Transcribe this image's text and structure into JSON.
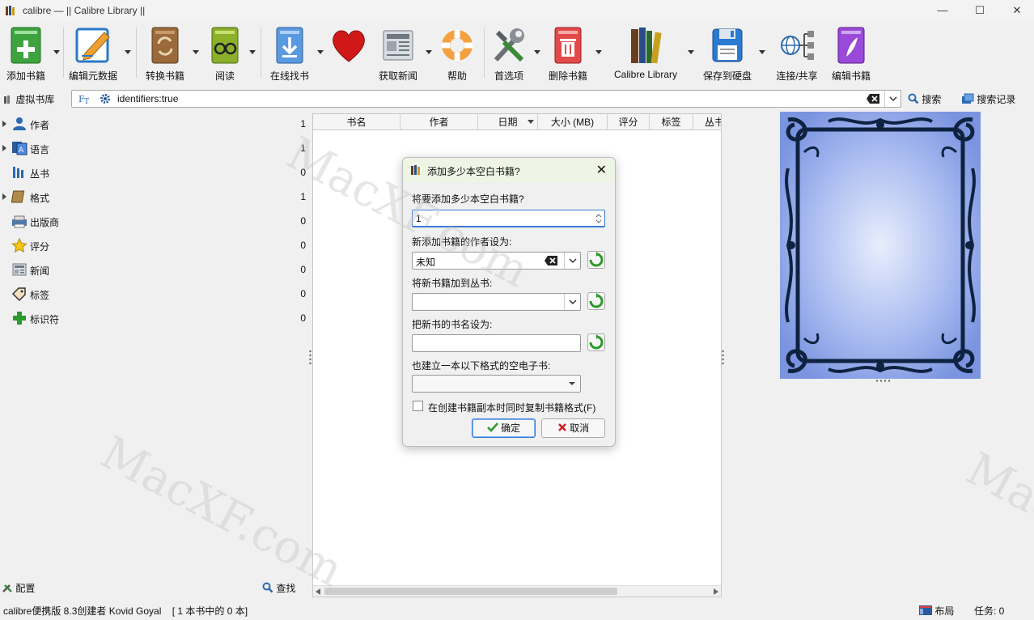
{
  "window": {
    "title": "calibre — || Calibre Library ||"
  },
  "toolbar": {
    "items": [
      {
        "label": "添加书籍"
      },
      {
        "label": "编辑元数据"
      },
      {
        "label": "转换书籍"
      },
      {
        "label": "阅读"
      },
      {
        "label": "在线找书"
      },
      {
        "label": "获取新闻"
      },
      {
        "label": "帮助"
      },
      {
        "label": "首选项"
      },
      {
        "label": "删除书籍"
      },
      {
        "label": "Calibre Library"
      },
      {
        "label": "保存到硬盘"
      },
      {
        "label": "连接/共享"
      },
      {
        "label": "编辑书籍"
      }
    ]
  },
  "search": {
    "virtual_library": "虚拟书库",
    "query": "identifiers:true",
    "search_button": "搜索",
    "history_button": "搜索记录"
  },
  "tag_browser": {
    "items": [
      {
        "label": "作者",
        "count": "1"
      },
      {
        "label": "语言",
        "count": "1"
      },
      {
        "label": "丛书",
        "count": "0"
      },
      {
        "label": "格式",
        "count": "1"
      },
      {
        "label": "出版商",
        "count": "0"
      },
      {
        "label": "评分",
        "count": "0"
      },
      {
        "label": "新闻",
        "count": "0"
      },
      {
        "label": "标签",
        "count": "0"
      },
      {
        "label": "标识符",
        "count": "0"
      }
    ],
    "configure": "配置",
    "find": "查找"
  },
  "book_list": {
    "columns": [
      "书名",
      "作者",
      "日期",
      "大小 (MB)",
      "评分",
      "标签",
      "丛书"
    ]
  },
  "dialog": {
    "title": "添加多少本空白书籍?",
    "q_count": "将要添加多少本空白书籍?",
    "count_value": "1",
    "q_author": "新添加书籍的作者设为:",
    "author_value": "未知",
    "q_series": "将新书籍加到丛书:",
    "q_title": "把新书的书名设为:",
    "q_format": "也建立一本以下格式的空电子书:",
    "copy_formats": "在创建书籍副本时同时复制书籍格式(F)",
    "ok": "确定",
    "cancel": "取消"
  },
  "status": {
    "left": "calibre便携版 8.3创建者 Kovid Goyal",
    "count_info": "[ 1 本书中的 0 本]",
    "layout": "布局",
    "jobs": "任务:  0"
  },
  "watermark": "MacXF.com"
}
